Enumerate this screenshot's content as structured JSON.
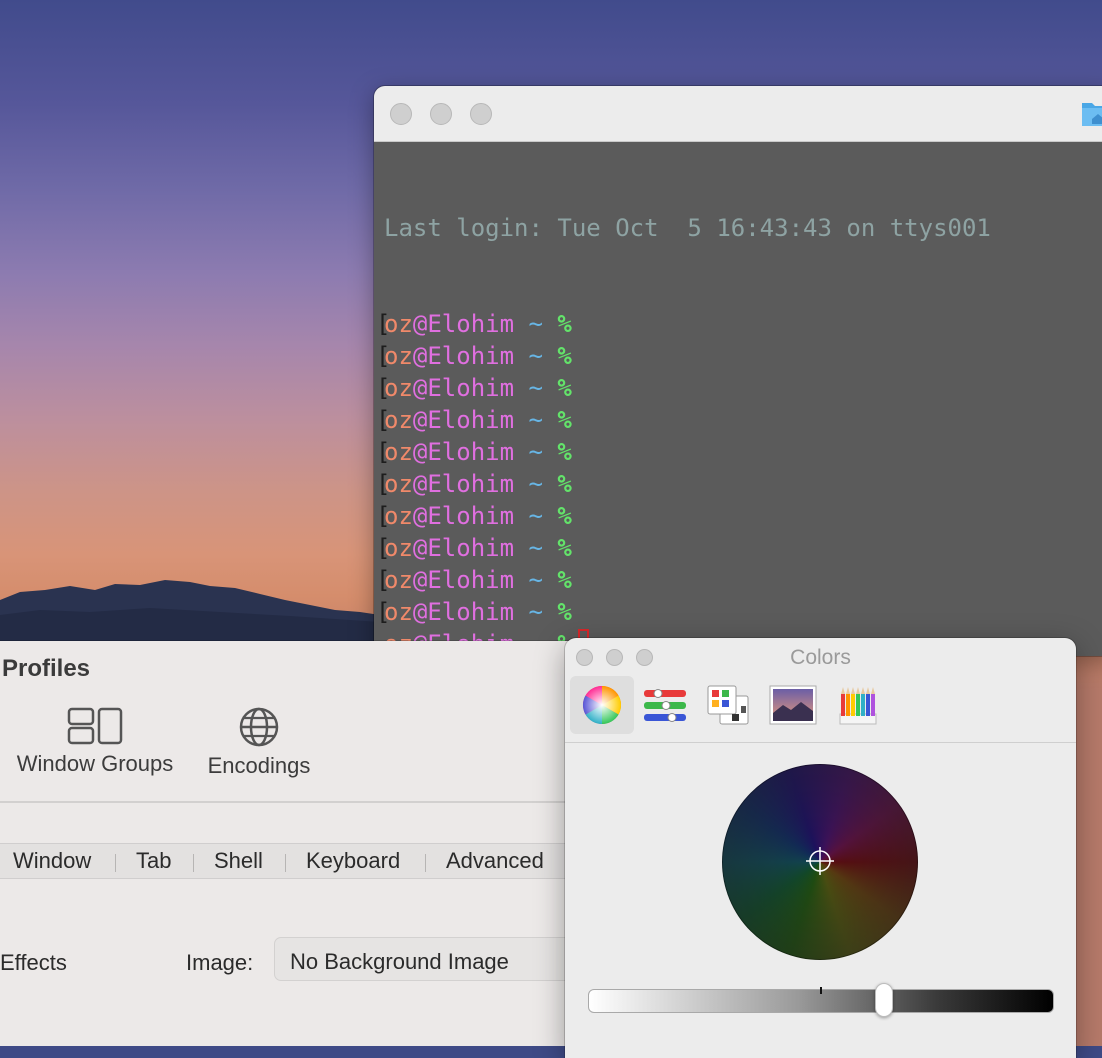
{
  "terminal": {
    "login_line": "Last login: Tue Oct  5 16:43:43 on ttys001",
    "prompt": {
      "user": "oz",
      "at": "@",
      "host": "Elohim",
      "tilde": "~",
      "symbol": "%"
    },
    "prompt_lines": 11,
    "colors": {
      "background": "#5b5b5b",
      "user": "#f0896a",
      "host": "#e06fe0",
      "tilde": "#67b6e6",
      "percent": "#63e36a",
      "cursor": "#d8272a"
    }
  },
  "prefs": {
    "title": "Profiles",
    "toolbar": {
      "window_groups": "Window Groups",
      "encodings": "Encodings"
    },
    "tabs": [
      "Window",
      "Tab",
      "Shell",
      "Keyboard",
      "Advanced"
    ],
    "effects_label": "Effects",
    "image_label": "Image:",
    "image_value": "No Background Image"
  },
  "colors_panel": {
    "title": "Colors",
    "tools": [
      "color-wheel-icon",
      "color-sliders-icon",
      "color-palettes-icon",
      "image-palettes-icon",
      "pencils-icon"
    ],
    "selected_tool": "color-wheel-icon",
    "brightness_fraction": 0.33
  }
}
